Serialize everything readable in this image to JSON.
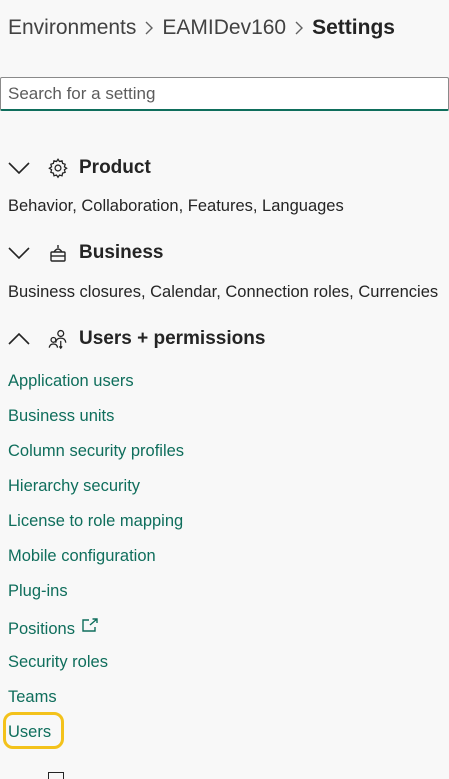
{
  "breadcrumb": {
    "items": [
      "Environments",
      "EAMIDev160"
    ],
    "current": "Settings"
  },
  "search": {
    "placeholder": "Search for a setting"
  },
  "groups": [
    {
      "title": "Product",
      "expanded": false,
      "icon": "gear-icon",
      "description": "Behavior, Collaboration, Features, Languages"
    },
    {
      "title": "Business",
      "expanded": false,
      "icon": "business-icon",
      "description": "Business closures, Calendar, Connection roles, Currencies"
    },
    {
      "title": "Users + permissions",
      "expanded": true,
      "icon": "people-icon",
      "items": [
        "Application users",
        "Business units",
        "Column security profiles",
        "Hierarchy security",
        "License to role mapping",
        "Mobile configuration",
        "Plug-ins",
        "Positions",
        "Security roles",
        "Teams",
        "Users"
      ]
    }
  ],
  "colors": {
    "link": "#0f6e5c",
    "highlight": "#f3c21b",
    "text": "#242424"
  }
}
